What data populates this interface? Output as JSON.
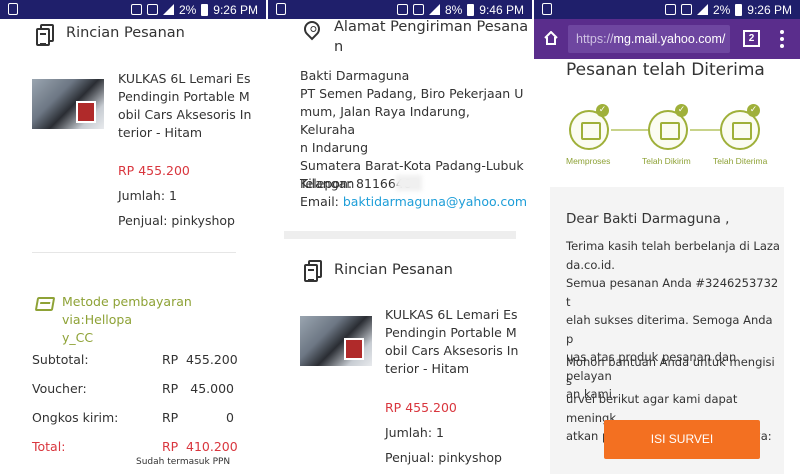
{
  "status_bar": {
    "battery": "2%",
    "time": "9:26 PM",
    "battery_2": "8%",
    "time_2": "9:46 PM"
  },
  "panel1": {
    "section_title": "Rincian Pesanan",
    "product_lines": [
      "KULKAS 6L Lemari Es",
      "Pendingin Portable M",
      "obil Cars Aksesoris In",
      "terior - Hitam"
    ],
    "price": "RP 455.200",
    "quantity": "Jumlah: 1",
    "seller": "Penjual: pinkyshop",
    "payment_lines": [
      "Metode pembayaran via:Hellopa",
      "y_CC"
    ],
    "summary": [
      {
        "label": "Subtotal:",
        "currency": "RP",
        "amount": "455.200"
      },
      {
        "label": "Voucher:",
        "currency": "RP",
        "amount": "45.000"
      },
      {
        "label": "Ongkos kirim:",
        "currency": "RP",
        "amount": "0"
      }
    ],
    "total": {
      "label": "Total:",
      "currency": "RP",
      "amount": "410.200"
    },
    "tax_note": "Sudah termasuk PPN"
  },
  "panel2": {
    "address_title_lines": [
      "Alamat Pengiriman Pesana",
      "n"
    ],
    "name": "Bakti Darmaguna",
    "address_lines": [
      "PT Semen Padang, Biro Pekerjaan U",
      "mum, Jalan Raya Indarung, Keluraha",
      "n Indarung",
      "Sumatera Barat-Kota Padang-Lubuk",
      "Kilangan"
    ],
    "phone": "Telepon: 8116648",
    "email_label": "Email: ",
    "email": "baktidarmaguna@yahoo.com",
    "section_title": "Rincian Pesanan",
    "product_lines": [
      "KULKAS 6L Lemari Es",
      "Pendingin Portable M",
      "obil Cars Aksesoris In",
      "terior - Hitam"
    ],
    "price": "RP 455.200",
    "quantity": "Jumlah: 1",
    "seller": "Penjual: pinkyshop"
  },
  "panel3": {
    "url_scheme": "https://",
    "url_host": "mg.mail.yahoo.com/",
    "tab_count": "2",
    "heading": "Pesanan telah Diterima",
    "steps": [
      "Memproses",
      "Telah Dikirim",
      "Telah Diterima"
    ],
    "greeting": "Dear Bakti Darmaguna ,",
    "para1_lines": [
      "Terima kasih telah berbelanja di Laza",
      "da.co.id.",
      "Semua pesanan Anda #3246253732 t",
      "elah sukses diterima. Semoga Anda p",
      "uas atas produk pesanan dan pelayan",
      "an kami."
    ],
    "para2_lines": [
      "Mohon bantuan Anda untuk mengisi s",
      "urvei berikut agar kami dapat meningk",
      "atkan pelayanan kami kedepannya:"
    ],
    "survey_button": "ISI SURVEI"
  },
  "colors": {
    "status_bar": "#1f1f6b",
    "browser_bar": "#5a2d8c",
    "price_red": "#d9363e",
    "accent_green": "#8ea236",
    "link_blue": "#1e9ed8",
    "survey_orange": "#f37021"
  },
  "icons": [
    "document-icon",
    "location-pin-icon",
    "payment-card-icon",
    "home-icon",
    "tabs-icon",
    "overflow-menu-icon",
    "check-icon"
  ]
}
